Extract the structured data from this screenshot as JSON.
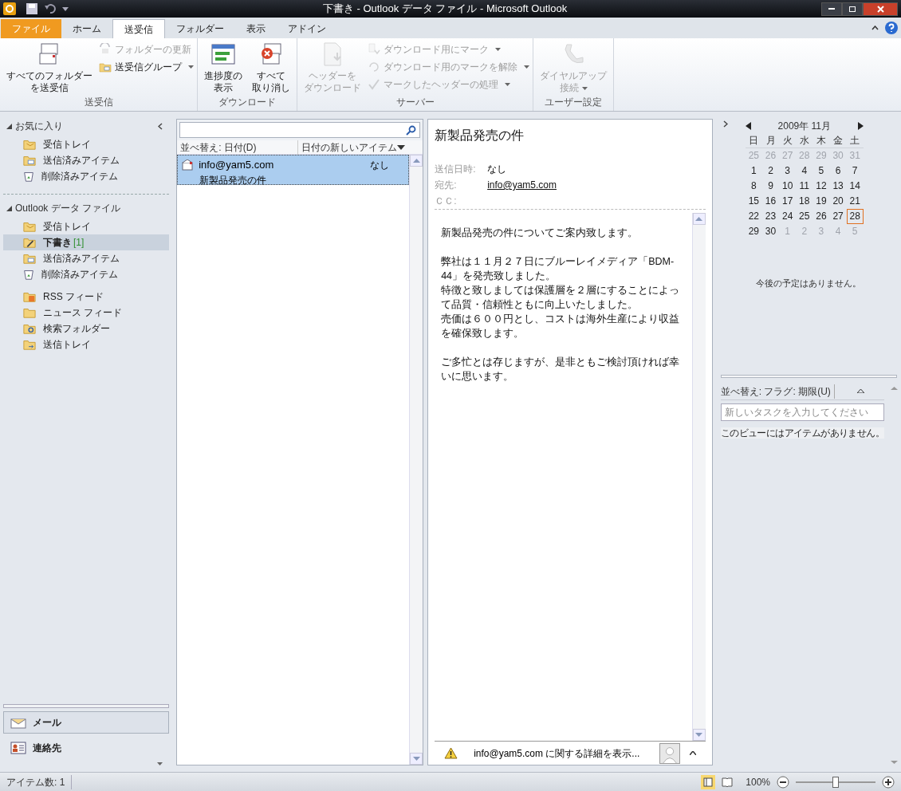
{
  "window": {
    "title": "下書き - Outlook データ ファイル  -  Microsoft Outlook"
  },
  "tabs": [
    {
      "label": "ファイル",
      "kind": "file",
      "selected": false
    },
    {
      "label": "ホーム",
      "kind": "tab",
      "selected": false
    },
    {
      "label": "送受信",
      "kind": "tab",
      "selected": true
    },
    {
      "label": "フォルダー",
      "kind": "tab",
      "selected": false
    },
    {
      "label": "表示",
      "kind": "tab",
      "selected": false
    },
    {
      "label": "アドイン",
      "kind": "tab",
      "selected": false
    }
  ],
  "ribbon": {
    "groups": [
      {
        "label": "送受信",
        "buttons": [
          {
            "kind": "large",
            "lines": [
              "すべてのフォルダー",
              "を送受信"
            ],
            "disabled": false,
            "dropdown": false
          },
          {
            "kind": "small",
            "lines": [
              "フォルダーの更新"
            ],
            "disabled": true,
            "dropdown": false
          },
          {
            "kind": "small",
            "lines": [
              "送受信グループ"
            ],
            "disabled": false,
            "dropdown": true
          }
        ]
      },
      {
        "label": "ダウンロード",
        "buttons": [
          {
            "kind": "large",
            "lines": [
              "進捗度の",
              "表示"
            ],
            "disabled": false,
            "dropdown": false
          },
          {
            "kind": "large",
            "lines": [
              "すべて",
              "取り消し"
            ],
            "disabled": false,
            "dropdown": false
          }
        ]
      },
      {
        "label": "サーバー",
        "buttons": [
          {
            "kind": "large",
            "lines": [
              "ヘッダーを",
              "ダウンロード"
            ],
            "disabled": true,
            "dropdown": false
          },
          {
            "kind": "small",
            "lines": [
              "ダウンロード用にマーク"
            ],
            "disabled": true,
            "dropdown": true
          },
          {
            "kind": "small",
            "lines": [
              "ダウンロード用のマークを解除"
            ],
            "disabled": true,
            "dropdown": true
          },
          {
            "kind": "small",
            "lines": [
              "マークしたヘッダーの処理"
            ],
            "disabled": true,
            "dropdown": true
          }
        ]
      },
      {
        "label": "ユーザー設定",
        "buttons": [
          {
            "kind": "large",
            "lines": [
              "ダイヤルアップ",
              "接続"
            ],
            "disabled": true,
            "dropdown": true
          }
        ]
      }
    ]
  },
  "nav": {
    "sections": [
      {
        "title": "お気に入り",
        "expanded": true,
        "items": [
          {
            "label": "受信トレイ",
            "kind": "inbox",
            "selected": false
          },
          {
            "label": "送信済みアイテム",
            "kind": "sent",
            "selected": false
          },
          {
            "label": "削除済みアイテム",
            "kind": "deleted",
            "selected": false
          }
        ]
      },
      {
        "title": "Outlook データ ファイル",
        "expanded": true,
        "items": [
          {
            "label": "受信トレイ",
            "kind": "inbox",
            "selected": false
          },
          {
            "label": "下書き",
            "count": "[1]",
            "kind": "drafts",
            "selected": true
          },
          {
            "label": "送信済みアイテム",
            "kind": "sent",
            "selected": false
          },
          {
            "label": "削除済みアイテム",
            "kind": "deleted",
            "selected": false
          },
          {
            "label": "RSS フィード",
            "kind": "rss",
            "selected": false
          },
          {
            "label": "ニュース フィード",
            "kind": "news",
            "selected": false
          },
          {
            "label": "検索フォルダー",
            "kind": "search",
            "selected": false
          },
          {
            "label": "送信トレイ",
            "kind": "outbox",
            "selected": false
          }
        ]
      }
    ],
    "modules": [
      {
        "label": "メール",
        "kind": "mail",
        "selected": true
      },
      {
        "label": "連絡先",
        "kind": "contacts",
        "selected": false
      }
    ]
  },
  "message_list": {
    "sort_label": "並べ替え: 日付(D)",
    "order_label": "日付の新しいアイテム",
    "rows": [
      {
        "from": "info@yam5.com",
        "subject": "新製品発売の件",
        "date": "なし",
        "selected": true
      }
    ]
  },
  "reading": {
    "subject": "新製品発売の件",
    "fields": [
      {
        "label": "送信日時:",
        "value": "なし",
        "kind": "text"
      },
      {
        "label": "宛先:",
        "value": "info@yam5.com",
        "kind": "link"
      },
      {
        "label": "ＣＣ:"
      }
    ],
    "body": [
      [
        "新製品発売の件についてご案内致します。"
      ],
      [
        "弊社は１１月２７日にブルーレイメディア「BDM-44」を発売致しました。",
        "特徴と致しましては保護層を２層にすることによって品質・信頼性ともに向上いたしました。",
        "売価は６００円とし、コストは海外生産により収益を確保致します。"
      ],
      [
        "ご多忙とは存じますが、是非ともご検討頂ければ幸いに思います。"
      ]
    ],
    "people_pane": "info@yam5.com に関する詳細を表示..."
  },
  "todo": {
    "calendar": {
      "title": "2009年 11月",
      "weekdays": [
        "日",
        "月",
        "火",
        "水",
        "木",
        "金",
        "土"
      ],
      "days": [
        {
          "d": "25",
          "dim": true,
          "today": false
        },
        {
          "d": "26",
          "dim": true,
          "today": false
        },
        {
          "d": "27",
          "dim": true,
          "today": false
        },
        {
          "d": "28",
          "dim": true,
          "today": false
        },
        {
          "d": "29",
          "dim": true,
          "today": false
        },
        {
          "d": "30",
          "dim": true,
          "today": false
        },
        {
          "d": "31",
          "dim": true,
          "today": false
        },
        {
          "d": "1",
          "dim": false,
          "today": false
        },
        {
          "d": "2",
          "dim": false,
          "today": false
        },
        {
          "d": "3",
          "dim": false,
          "today": false
        },
        {
          "d": "4",
          "dim": false,
          "today": false
        },
        {
          "d": "5",
          "dim": false,
          "today": false
        },
        {
          "d": "6",
          "dim": false,
          "today": false
        },
        {
          "d": "7",
          "dim": false,
          "today": false
        },
        {
          "d": "8",
          "dim": false,
          "today": false
        },
        {
          "d": "9",
          "dim": false,
          "today": false
        },
        {
          "d": "10",
          "dim": false,
          "today": false
        },
        {
          "d": "11",
          "dim": false,
          "today": false
        },
        {
          "d": "12",
          "dim": false,
          "today": false
        },
        {
          "d": "13",
          "dim": false,
          "today": false
        },
        {
          "d": "14",
          "dim": false,
          "today": false
        },
        {
          "d": "15",
          "dim": false,
          "today": false
        },
        {
          "d": "16",
          "dim": false,
          "today": false
        },
        {
          "d": "17",
          "dim": false,
          "today": false
        },
        {
          "d": "18",
          "dim": false,
          "today": false
        },
        {
          "d": "19",
          "dim": false,
          "today": false
        },
        {
          "d": "20",
          "dim": false,
          "today": false
        },
        {
          "d": "21",
          "dim": false,
          "today": false
        },
        {
          "d": "22",
          "dim": false,
          "today": false
        },
        {
          "d": "23",
          "dim": false,
          "today": false
        },
        {
          "d": "24",
          "dim": false,
          "today": false
        },
        {
          "d": "25",
          "dim": false,
          "today": false
        },
        {
          "d": "26",
          "dim": false,
          "today": false
        },
        {
          "d": "27",
          "dim": false,
          "today": false
        },
        {
          "d": "28",
          "dim": false,
          "today": true
        },
        {
          "d": "29",
          "dim": false,
          "today": false
        },
        {
          "d": "30",
          "dim": false,
          "today": false
        },
        {
          "d": "1",
          "dim": true,
          "today": false
        },
        {
          "d": "2",
          "dim": true,
          "today": false
        },
        {
          "d": "3",
          "dim": true,
          "today": false
        },
        {
          "d": "4",
          "dim": true,
          "today": false
        },
        {
          "d": "5",
          "dim": true,
          "today": false
        }
      ]
    },
    "no_appointments": "今後の予定はありません。",
    "tasks": {
      "sort_label": "並べ替え: フラグ: 期限(U)",
      "placeholder": "新しいタスクを入力してください",
      "empty": "このビューにはアイテムがありません。"
    }
  },
  "status_bar": {
    "count": "アイテム数: 1",
    "zoom": "100%",
    "level": 0.5
  }
}
